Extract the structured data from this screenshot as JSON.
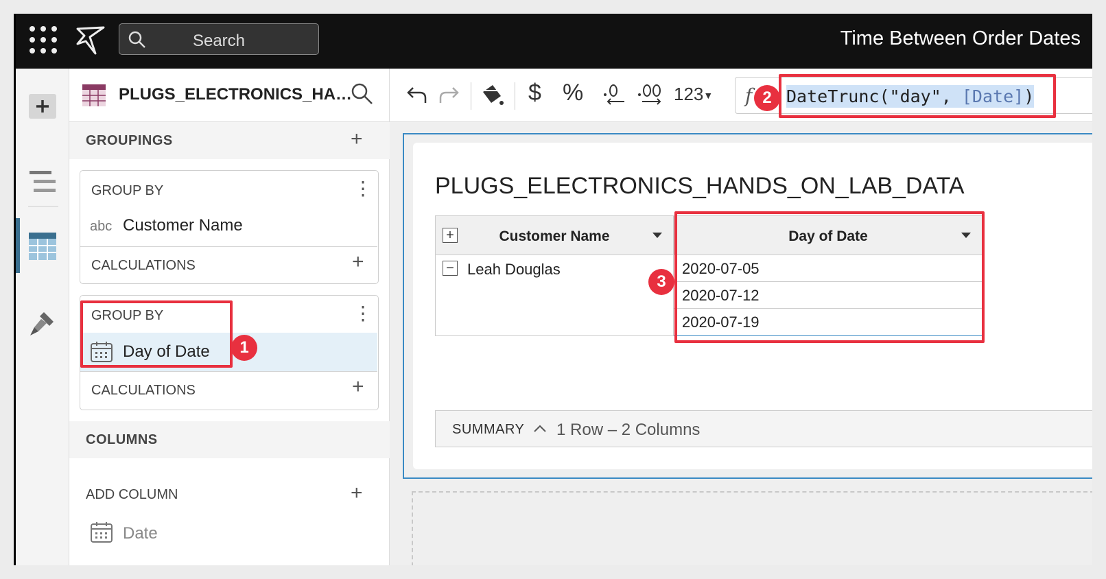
{
  "topbar": {
    "search_placeholder": "Search",
    "doc_title": "Time Between Order Dates"
  },
  "panel": {
    "source_title": "PLUGS_ELECTRONICS_HA…",
    "groupings_label": "GROUPINGS",
    "group1": {
      "group_by_label": "GROUP BY",
      "type_badge": "abc",
      "column": "Customer Name",
      "calculations_label": "CALCULATIONS"
    },
    "group2": {
      "group_by_label": "GROUP BY",
      "column": "Day of Date",
      "calculations_label": "CALCULATIONS"
    },
    "columns_label": "COLUMNS",
    "add_column_label": "ADD COLUMN",
    "columns": [
      "Date"
    ]
  },
  "toolbar": {
    "number_format": "123",
    "currency_symbol": "$",
    "percent_symbol": "%",
    "fx_label": "f",
    "formula_prefix": "DateTrunc(\"day\", ",
    "formula_ref": "[Date]",
    "formula_suffix": ")"
  },
  "table": {
    "title": "PLUGS_ELECTRONICS_HANDS_ON_LAB_DATA",
    "headers": [
      "Customer Name",
      "Day of Date"
    ],
    "customer": "Leah Douglas",
    "dates": [
      "2020-07-05",
      "2020-07-12",
      "2020-07-19"
    ]
  },
  "summary": {
    "label": "SUMMARY",
    "info": "1 Row – 2 Columns"
  },
  "annotations": [
    "1",
    "2",
    "3"
  ],
  "colors": {
    "annotation": "#e8303f",
    "selection": "#cfe2f7",
    "topbar": "#111111"
  }
}
